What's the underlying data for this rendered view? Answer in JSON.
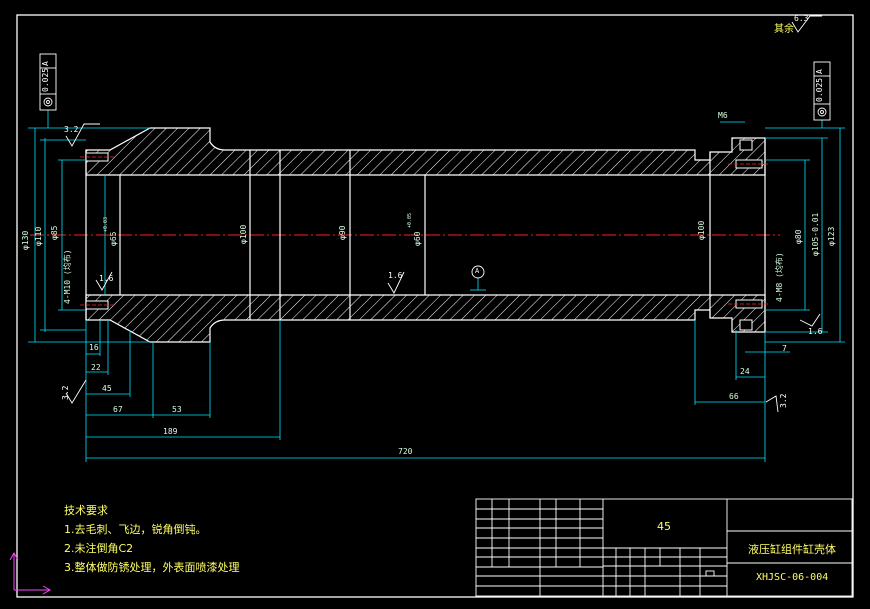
{
  "colors": {
    "background": "#000000",
    "outline": "#ffffff",
    "dimension": "#00e5ff",
    "centerline": "#ff2020",
    "text": "#ffff66",
    "ucs": "#ff44ff"
  },
  "roughness": {
    "general": "6.3",
    "general_note": "其余",
    "surface_a": "3.2",
    "surface_b": "1.6",
    "surface_c": "3.2",
    "surface_d": "1.6",
    "surface_e": "3.2",
    "surface_f": "1.6"
  },
  "tolerance": {
    "left_value": "0.025",
    "left_datum": "A",
    "right_value": "0.025",
    "right_datum": "A",
    "datum_label": "A"
  },
  "dims_h": {
    "d16": "16",
    "d22": "22",
    "d45": "45",
    "d67": "67",
    "d53": "53",
    "d189": "189",
    "d720": "720",
    "d66": "66",
    "d24": "24",
    "d7": "7",
    "thread_m6": "M6"
  },
  "dims_v": {
    "d130": "φ130",
    "d110": "φ110",
    "d85": "φ85",
    "d65": "φ65",
    "d65_tol": "+0.03",
    "d100a": "φ100",
    "d90": "φ90",
    "d60": "φ60",
    "d60_tol": "+0.05",
    "d100b": "φ100",
    "d80": "φ80",
    "d105": "φ105-0.01",
    "d123": "φ123",
    "holes_left": "4-M10 (均布)",
    "holes_right": "4-M8 (均布)"
  },
  "notes": {
    "title": "技术要求",
    "line1": "1.去毛刺、飞边，锐角倒钝。",
    "line2": "2.未注倒角C2",
    "line3": "3.整体做防锈处理，外表面喷漆处理"
  },
  "title_block": {
    "material": "45",
    "part_name": "液压缸组件缸壳体",
    "drawing_no": "XHJSC-06-004"
  }
}
